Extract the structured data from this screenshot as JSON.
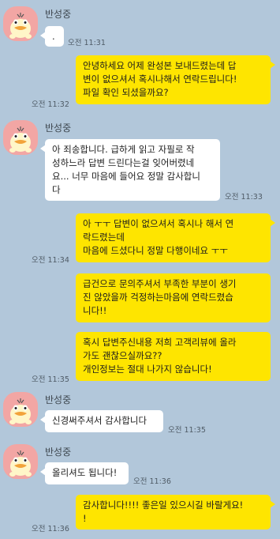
{
  "chat": {
    "colors": {
      "background": "#b2c7da",
      "incoming": "#ffffff",
      "outgoing": "#fee500",
      "avatar": "#f2a6a4"
    },
    "messages": [
      {
        "sender_name": "반성중",
        "text": ".",
        "time": "오전 11:31"
      },
      {
        "text": "안녕하세요 어제 완성본 보내드렸는데 답\n변이 없으셔서 혹시나해서 연락드립니다!\n파일 확인 되셨을까요?",
        "time": "오전 11:32"
      },
      {
        "sender_name": "반성중",
        "text": "아 죄송합니다. 급하게 읽고 자필로 작\n성하느라 답변 드린다는걸 잊어버렸네\n요... 너무 마음에 들어요 정말 감사합니\n다",
        "time": "오전 11:33"
      },
      {
        "text": "아 ㅜㅜ 답변이 없으셔서 혹시나 해서 연\n락드렸는데\n마음에 드셨다니 정말 다행이네요 ㅜㅜ",
        "time": "오전 11:34"
      },
      {
        "text": "급건으로 문의주셔서 부족한 부분이 생기\n진 않았을까 걱정하는마음에 연락드렸습\n니다!!"
      },
      {
        "text": "혹시 답변주신내용 저희 고객리뷰에 올라\n가도 괜찮으실까요??\n개인정보는 절대 나가지 않습니다!",
        "time": "오전 11:35"
      },
      {
        "sender_name": "반성중",
        "text": "신경써주셔서 감사합니다",
        "time": "오전 11:35"
      },
      {
        "sender_name": "반성중",
        "text": "올리셔도 됩니다!",
        "time": "오전 11:36"
      },
      {
        "text": "감사합니다!!!! 좋은일 있으시길 바랄게요!\n!",
        "time": "오전 11:36"
      }
    ]
  }
}
